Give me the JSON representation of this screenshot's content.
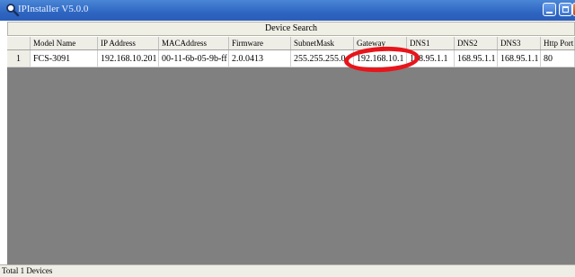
{
  "window": {
    "title": "IPInstaller V5.0.0",
    "icon": "magnifier-icon"
  },
  "toolbar": {
    "search_label": "Device Search"
  },
  "table": {
    "columns": [
      "",
      "Model Name",
      "IP Address",
      "MACAddress",
      "Firmware",
      "SubnetMask",
      "Gateway",
      "DNS1",
      "DNS2",
      "DNS3",
      "Http Port"
    ],
    "rows": [
      [
        "1",
        "FCS-3091",
        "192.168.10.201",
        "00-11-6b-05-9b-ff",
        "2.0.0413",
        "255.255.255.0",
        "192.168.10.1",
        "168.95.1.1",
        "168.95.1.1",
        "168.95.1.1",
        "80"
      ]
    ]
  },
  "status": {
    "text": "Total 1 Devices"
  },
  "colors": {
    "titlebar": "#2e66c2",
    "grid_background": "#808080",
    "highlight": "#e8141b"
  }
}
